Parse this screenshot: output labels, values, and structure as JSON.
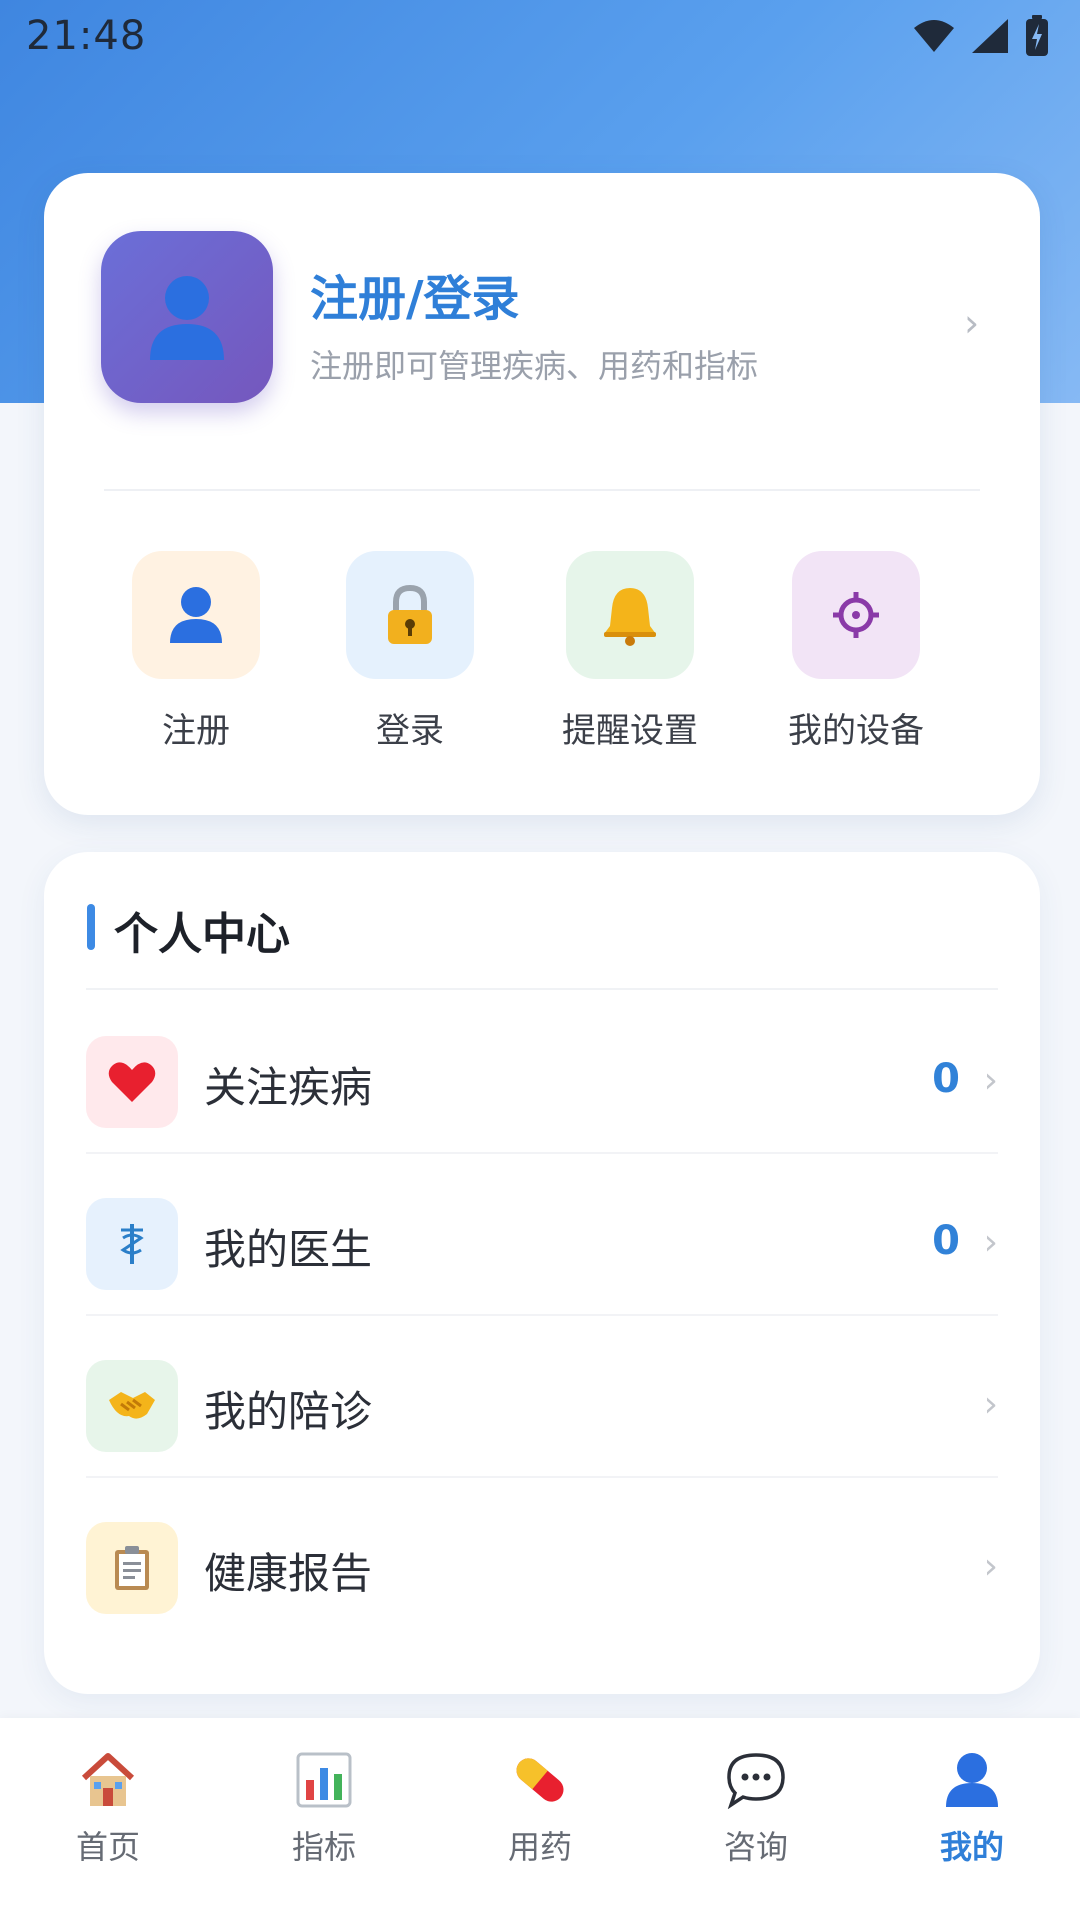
{
  "status_bar": {
    "time": "21:48"
  },
  "profile": {
    "title": "注册/登录",
    "subtitle": "注册即可管理疾病、用药和指标"
  },
  "quick_actions": [
    {
      "label": "注册",
      "icon": "user-icon",
      "tile_color": "#fff2e2"
    },
    {
      "label": "登录",
      "icon": "lock-icon",
      "tile_color": "#e5f1fd"
    },
    {
      "label": "提醒设置",
      "icon": "bell-icon",
      "tile_color": "#e6f5ea"
    },
    {
      "label": "我的设备",
      "icon": "device-gear-icon",
      "tile_color": "#f2e4f6"
    }
  ],
  "personal_center": {
    "title": "个人中心",
    "items": [
      {
        "label": "关注疾病",
        "count": "0",
        "icon": "heart-icon",
        "tile_color": "#ffe9ec"
      },
      {
        "label": "我的医生",
        "count": "0",
        "icon": "medical-staff-icon",
        "tile_color": "#e6f1fd"
      },
      {
        "label": "我的陪诊",
        "count": "",
        "icon": "handshake-icon",
        "tile_color": "#e7f5ea"
      },
      {
        "label": "健康报告",
        "count": "",
        "icon": "clipboard-icon",
        "tile_color": "#fff3d4"
      }
    ]
  },
  "tabbar": {
    "active": "我的",
    "tabs": [
      {
        "label": "首页",
        "icon": "home-icon"
      },
      {
        "label": "指标",
        "icon": "chart-icon"
      },
      {
        "label": "用药",
        "icon": "pill-icon"
      },
      {
        "label": "咨询",
        "icon": "chat-icon"
      },
      {
        "label": "我的",
        "icon": "profile-icon"
      }
    ]
  },
  "colors": {
    "accent": "#2f7fd8",
    "header_gradient_start": "#3f86e0",
    "header_gradient_end": "#86b9f4",
    "avatar_start": "#6b6fd8",
    "avatar_end": "#7557bd"
  }
}
